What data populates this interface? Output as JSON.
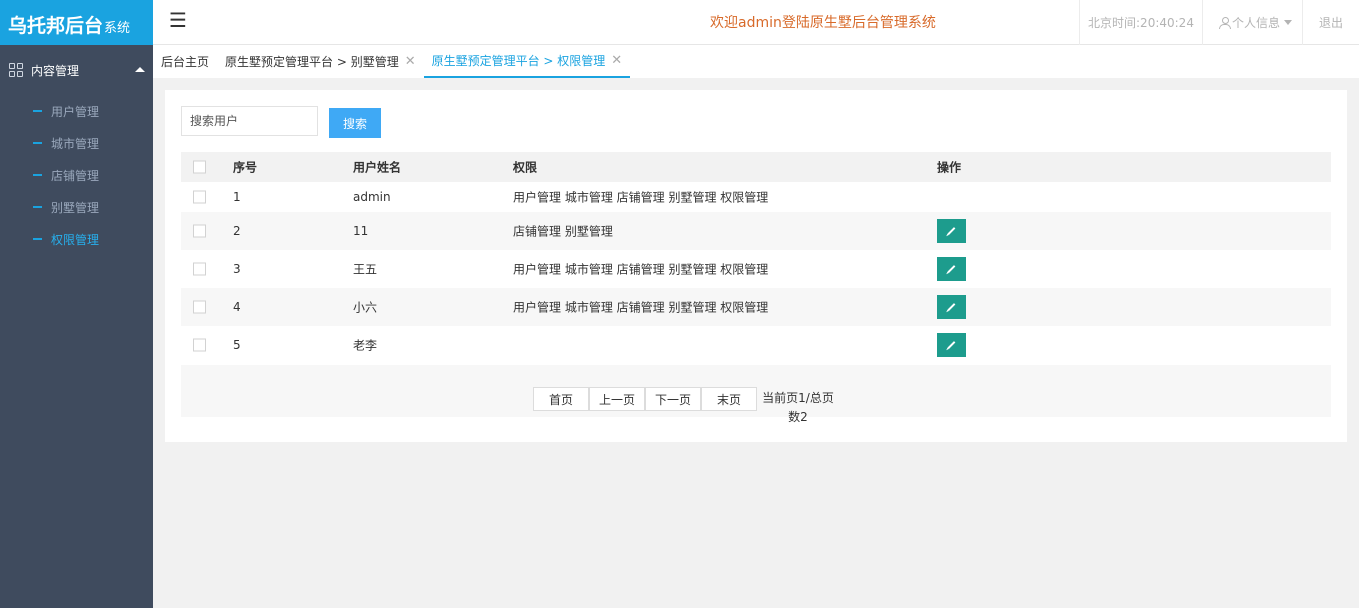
{
  "logo": {
    "main": "乌托邦后台",
    "sub": "系统"
  },
  "sidebar": {
    "group": {
      "label": "内容管理"
    },
    "items": [
      {
        "label": "用户管理"
      },
      {
        "label": "城市管理"
      },
      {
        "label": "店铺管理"
      },
      {
        "label": "别墅管理"
      },
      {
        "label": "权限管理",
        "active": true
      }
    ]
  },
  "header": {
    "menu_glyph": "☰",
    "welcome": "欢迎admin登陆原生墅后台管理系统",
    "time": "北京时间:20:40:24",
    "profile": "个人信息",
    "logout": "退出"
  },
  "tabs": [
    {
      "label": "后台主页"
    },
    {
      "label": "原生墅预定管理平台 > 别墅管理",
      "close": "✕"
    },
    {
      "label": "原生墅预定管理平台 > 权限管理",
      "close": "✕",
      "active": true
    }
  ],
  "search": {
    "placeholder": "搜索用户",
    "button": "搜索"
  },
  "table": {
    "headers": {
      "no": "序号",
      "name": "用户姓名",
      "perm": "权限",
      "op": "操作"
    },
    "rows": [
      {
        "no": "1",
        "name": "admin",
        "perm": "用户管理 城市管理 店铺管理 别墅管理 权限管理",
        "edit": false
      },
      {
        "no": "2",
        "name": "11",
        "perm": "店铺管理 别墅管理",
        "edit": true
      },
      {
        "no": "3",
        "name": "王五",
        "perm": "用户管理 城市管理 店铺管理 别墅管理 权限管理",
        "edit": true
      },
      {
        "no": "4",
        "name": "小六",
        "perm": "用户管理 城市管理 店铺管理 别墅管理 权限管理",
        "edit": true
      },
      {
        "no": "5",
        "name": "老李",
        "perm": "",
        "edit": true
      }
    ]
  },
  "pager": {
    "first": "首页",
    "prev": "上一页",
    "next": "下一页",
    "last": "末页",
    "info": "当前页1/总页数2"
  },
  "colors": {
    "accent": "#1aa3e0",
    "sidebar": "#3f4b5e",
    "edit": "#1d9c8d",
    "welcome": "#d86a2a"
  }
}
